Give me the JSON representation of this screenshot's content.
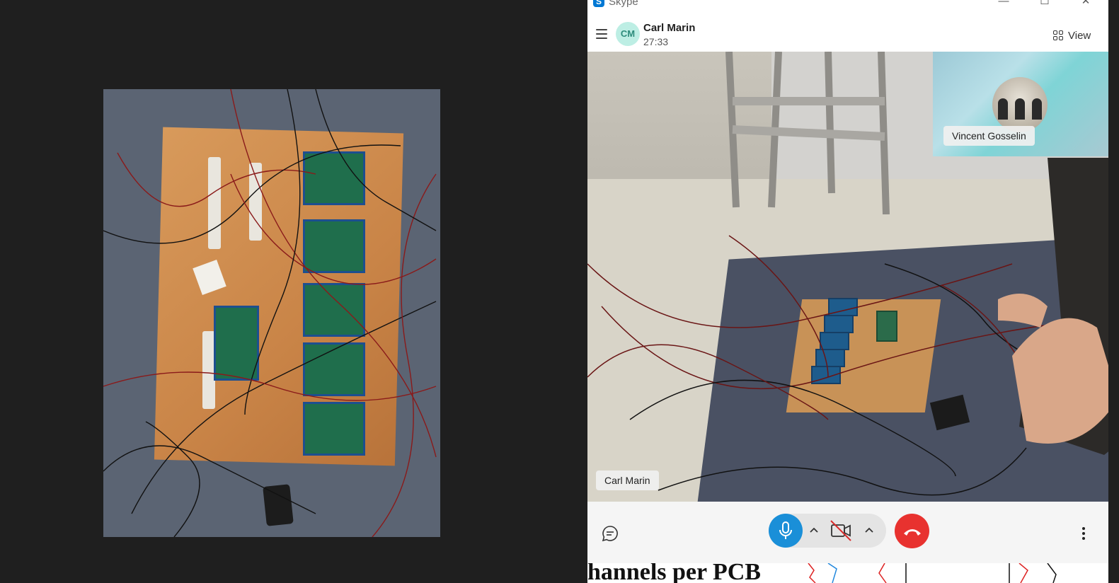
{
  "skype": {
    "app_title": "Skype",
    "logo_letter": "S",
    "window_controls": {
      "minimize": "—",
      "maximize": "☐",
      "close": "✕"
    }
  },
  "call": {
    "caller_initials": "CM",
    "caller_name": "Carl Marin",
    "duration": "27:33",
    "view_label": "View",
    "self_view_name": "Vincent Gosselin",
    "main_video_name": "Carl Marin"
  },
  "controls": {
    "icons": [
      "chat-icon",
      "microphone-icon",
      "camera-off-icon",
      "end-call-icon",
      "more-options-icon"
    ],
    "colors": {
      "mic": "#1a8fd8",
      "end_call": "#e8322f"
    }
  },
  "background_doc": {
    "visible_text": "hannels per PCB"
  }
}
